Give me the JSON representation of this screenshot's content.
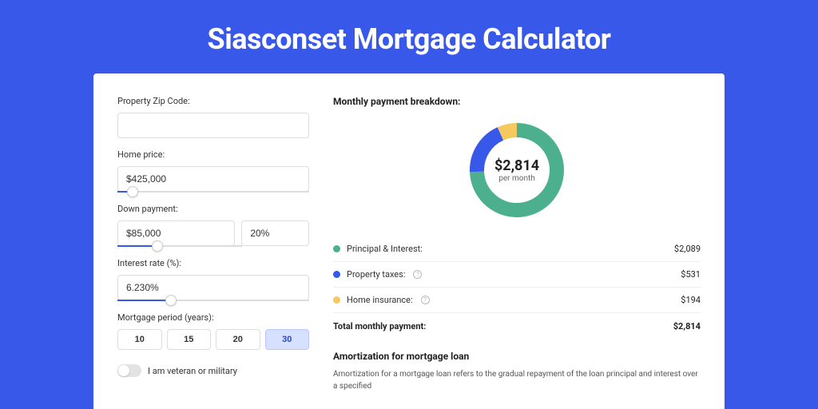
{
  "title": "Siasconset Mortgage Calculator",
  "form": {
    "zip_label": "Property Zip Code:",
    "zip_value": "",
    "home_price_label": "Home price:",
    "home_price_value": "$425,000",
    "home_price_slider_pct": 8,
    "down_payment_label": "Down payment:",
    "down_payment_value": "$85,000",
    "down_payment_pct_value": "20%",
    "down_payment_slider_pct": 20,
    "interest_label": "Interest rate (%):",
    "interest_value": "6.230%",
    "interest_slider_pct": 28,
    "period_label": "Mortgage period (years):",
    "periods": [
      "10",
      "15",
      "20",
      "30"
    ],
    "period_active_index": 3,
    "veteran_label": "I am veteran or military"
  },
  "breakdown": {
    "title": "Monthly payment breakdown:",
    "center_amount": "$2,814",
    "center_sub": "per month",
    "items": [
      {
        "label": "Principal & Interest:",
        "value": "$2,089",
        "color": "#4caf8e",
        "has_help": false
      },
      {
        "label": "Property taxes:",
        "value": "$531",
        "color": "#3858e9",
        "has_help": true
      },
      {
        "label": "Home insurance:",
        "value": "$194",
        "color": "#f4c95d",
        "has_help": true
      }
    ],
    "total_label": "Total monthly payment:",
    "total_value": "$2,814"
  },
  "amort": {
    "title": "Amortization for mortgage loan",
    "text": "Amortization for a mortgage loan refers to the gradual repayment of the loan principal and interest over a specified"
  },
  "chart_data": {
    "type": "pie",
    "title": "Monthly payment breakdown",
    "series": [
      {
        "name": "Principal & Interest",
        "value": 2089,
        "color": "#4caf8e"
      },
      {
        "name": "Property taxes",
        "value": 531,
        "color": "#3858e9"
      },
      {
        "name": "Home insurance",
        "value": 194,
        "color": "#f4c95d"
      }
    ],
    "total": 2814,
    "center_label": "$2,814 per month"
  }
}
